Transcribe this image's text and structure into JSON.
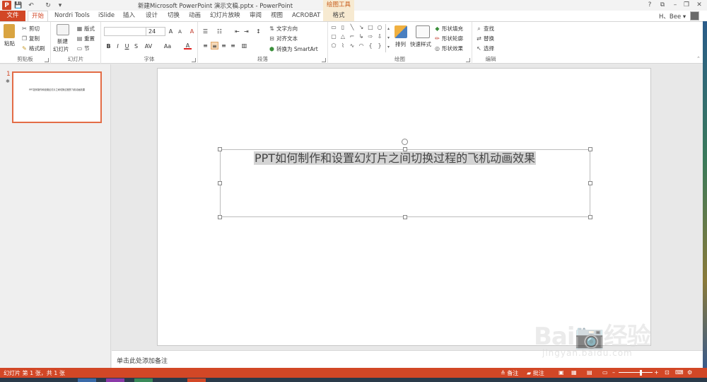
{
  "window": {
    "title": "新建Microsoft PowerPoint 演示文稿.pptx - PowerPoint",
    "contextual_tab_group": "绘图工具",
    "help": "?",
    "restore_ribbon": "⧉",
    "minimize": "–",
    "maximize": "❐",
    "close": "✕"
  },
  "quick_access": {
    "save_icon": "💾",
    "undo": "↶",
    "redo": "↻",
    "customize": "▾"
  },
  "tabs": [
    "文件",
    "开始",
    "Nordri Tools",
    "iSlide",
    "插入",
    "设计",
    "切换",
    "动画",
    "幻灯片放映",
    "审阅",
    "视图",
    "ACROBAT",
    "格式"
  ],
  "user": {
    "name": "H、Bee ▾"
  },
  "ribbon": {
    "clipboard": {
      "label": "剪贴板",
      "paste": "粘贴",
      "cut": "剪切",
      "copy": "复制",
      "format_painter": "格式刷"
    },
    "slides": {
      "label": "幻灯片",
      "new_slide_line1": "新建",
      "new_slide_line2": "幻灯片",
      "layout": "版式",
      "reset": "重置",
      "section": "节"
    },
    "font": {
      "label": "字体",
      "font_name": "",
      "font_size": "24",
      "grow": "A",
      "shrink": "A",
      "clear": "A",
      "bold": "B",
      "italic": "I",
      "underline": "U",
      "strike": "S",
      "spacing": "AV",
      "case": "Aa",
      "color": "A"
    },
    "paragraph": {
      "label": "段落",
      "text_direction": "文字方向",
      "align_text": "对齐文本",
      "convert_smartart": "转换为 SmartArt"
    },
    "drawing": {
      "label": "绘图",
      "arrange": "排列",
      "quick_styles": "快速样式",
      "shape_fill": "形状填充",
      "shape_outline": "形状轮廓",
      "shape_effects": "形状效果"
    },
    "editing": {
      "label": "编辑",
      "find": "查找",
      "replace": "替换",
      "select": "选择"
    }
  },
  "thumbnails": [
    {
      "number": "1",
      "marker": "✱",
      "text": "PPT如何制作和设置幻灯片之间切换过程的飞机动画效果"
    }
  ],
  "slide": {
    "title": "PPT如何制作和设置幻灯片之间切换过程的飞机动画效果"
  },
  "notes": {
    "placeholder": "单击此处添加备注"
  },
  "status": {
    "slide_info": "幻灯片 第 1 张，共 1 张",
    "notes": "备注",
    "comments": "批注",
    "zoom_minus": "–",
    "zoom_plus": "+",
    "zoom_level": 0.65
  },
  "watermark": {
    "logo": "Bai📷经验",
    "url": "jingyan.baidu.com"
  },
  "colors": {
    "accent": "#D24726",
    "contextual": "#F7EAD1",
    "selection_highlight": "#D4D4D4"
  }
}
